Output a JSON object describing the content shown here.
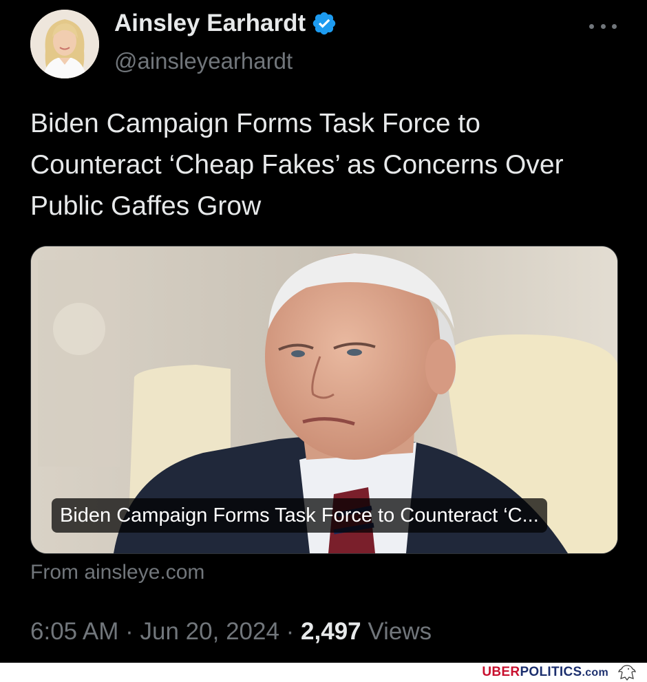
{
  "author": {
    "name": "Ainsley Earhardt",
    "handle": "@ainsleyearhardt",
    "verified": true,
    "avatar_icon": "profile-photo"
  },
  "tweet": {
    "text": "Biden Campaign Forms Task Force to Counteract ‘Cheap Fakes’ as Concerns Over Public Gaffes Grow",
    "more_icon": "more-horizontal-icon"
  },
  "card": {
    "title": "Biden Campaign Forms Task Force to Counteract ‘C...",
    "source": "From ainsleye.com"
  },
  "meta": {
    "time": "6:05 AM",
    "separator": " · ",
    "date": "Jun 20, 2024",
    "views_count": "2,497",
    "views_label": "Views"
  },
  "watermark": {
    "uber": "UBER",
    "politics": "POLITICS",
    "com": ".com"
  },
  "colors": {
    "background": "#000000",
    "text_primary": "#e7e9ea",
    "text_secondary": "#71767b",
    "verified_blue": "#1d9bf0",
    "watermark_red": "#c8102e",
    "watermark_blue": "#1c2f6e"
  }
}
